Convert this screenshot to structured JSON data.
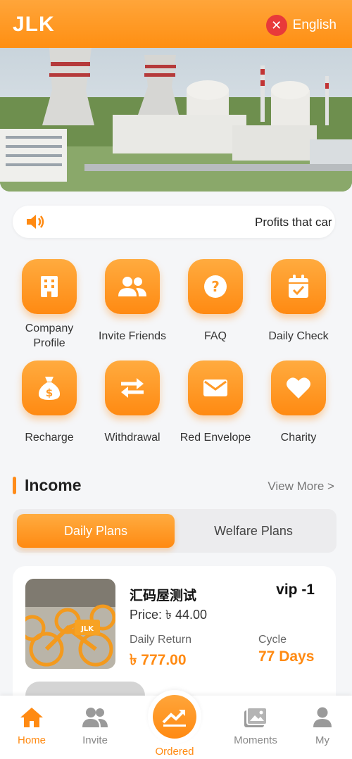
{
  "header": {
    "brand": "JLK",
    "language": "English",
    "language_icon": "close-x-icon"
  },
  "banner": {
    "icon": "nuclear-plant-image"
  },
  "notice": {
    "text": "Profits that car",
    "icon": "speaker-icon"
  },
  "menu": [
    {
      "label": "Company Profile",
      "icon": "building-icon"
    },
    {
      "label": "Invite Friends",
      "icon": "users-icon"
    },
    {
      "label": "FAQ",
      "icon": "question-icon"
    },
    {
      "label": "Daily Check",
      "icon": "calendar-check-icon"
    },
    {
      "label": "Recharge",
      "icon": "money-bag-icon"
    },
    {
      "label": "Withdrawal",
      "icon": "exchange-icon"
    },
    {
      "label": "Red Envelope",
      "icon": "envelope-icon"
    },
    {
      "label": "Charity",
      "icon": "heart-icon"
    }
  ],
  "income": {
    "title": "Income",
    "view_more": "View More >"
  },
  "tabs": {
    "active": "Daily Plans",
    "inactive": "Welfare Plans"
  },
  "product": {
    "name": "汇码屋测试",
    "vip": "vip -1",
    "price": "Price: ৳ 44.00",
    "daily_return_label": "Daily Return",
    "daily_return_value": "৳ 777.00",
    "cycle_label": "Cycle",
    "cycle_value": "77 Days",
    "image_text": "JLK"
  },
  "tabbar": {
    "home": "Home",
    "invite": "Invite",
    "ordered": "Ordered",
    "moments": "Moments",
    "my": "My"
  },
  "colors": {
    "accent": "#ff8a12",
    "header": "#ffa53a"
  }
}
